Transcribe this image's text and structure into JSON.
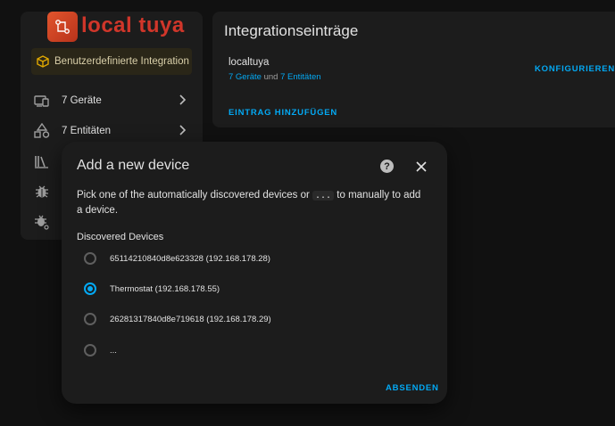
{
  "logo": {
    "text": "local tuya",
    "icon": "circuit-logo-icon",
    "brand_color": "#d0362a"
  },
  "sidebar": {
    "custom_integration_label": "Benutzerdefinierte Integration",
    "items": [
      {
        "icon": "devices-icon",
        "label": "7 Geräte"
      },
      {
        "icon": "shapes-icon",
        "label": "7 Entitäten"
      },
      {
        "icon": "library-icon",
        "label": ""
      },
      {
        "icon": "bug-icon",
        "label": ""
      },
      {
        "icon": "bug-settings-icon",
        "label": ""
      }
    ]
  },
  "integration": {
    "title": "Integrationseinträge",
    "entry_name": "localtuya",
    "devices_link": "7 Geräte",
    "and_text": "und",
    "entities_link": "7 Entitäten",
    "configure_label": "KONFIGURIEREN",
    "add_entry_label": "EINTRAG HINZUFÜGEN"
  },
  "dialog": {
    "title": "Add a new device",
    "help_icon": "help-circle-icon",
    "close_icon": "close-icon",
    "desc_before": "Pick one of the automatically discovered devices or",
    "desc_code": "...",
    "desc_after": "to manually to add a device.",
    "discovered_label": "Discovered Devices",
    "options": [
      {
        "label": "65114210840d8e623328 (192.168.178.28)",
        "checked": false
      },
      {
        "label": "Thermostat (192.168.178.55)",
        "checked": true
      },
      {
        "label": "26281317840d8e719618 (192.168.178.29)",
        "checked": false
      },
      {
        "label": "...",
        "checked": false
      }
    ],
    "submit_label": "ABSENDEN"
  },
  "colors": {
    "accent": "#03a9f4",
    "background": "#111111",
    "card": "#1c1c1c"
  }
}
